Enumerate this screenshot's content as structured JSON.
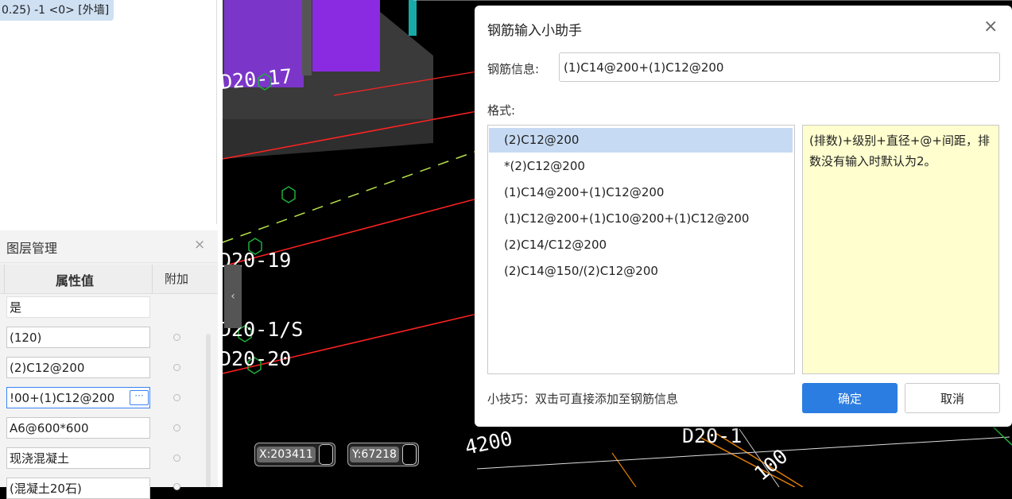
{
  "left_panel": {
    "selected_item": "0.25) -1 <0> [外墙]",
    "layer_panel": {
      "title": "图层管理",
      "close": "×",
      "column_value": "属性值",
      "column_extra": "附加",
      "rows": [
        "是",
        "(120)",
        "(2)C12@200",
        "!00+(1)C12@200",
        "A6@600*600",
        "现浇混凝土",
        "(混凝土20石)"
      ],
      "ellipsis": "···"
    },
    "collapse_arrow": "‹"
  },
  "cad": {
    "labels": [
      "D20-17",
      "D20-19",
      "D20-1/S",
      "D20-20",
      "D20-1",
      "4200",
      "100"
    ],
    "coord_x": "X:203411",
    "coord_y": "Y:67218"
  },
  "dialog": {
    "title": "钢筋输入小助手",
    "close": "×",
    "info_label": "钢筋信息:",
    "info_value": "(1)C14@200+(1)C12@200",
    "format_label": "格式:",
    "formats": [
      "(2)C12@200",
      "*(2)C12@200",
      "(1)C14@200+(1)C12@200",
      "(1)C12@200+(1)C10@200+(1)C12@200",
      "(2)C14/C12@200",
      "(2)C14@150/(2)C12@200"
    ],
    "selected_format_index": 0,
    "description": "(排数)+级别+直径+@+间距，排数没有输入时默认为2。",
    "tip": "小技巧：双击可直接添加至钢筋信息",
    "ok": "确定",
    "cancel": "取消"
  },
  "colors": {
    "accent": "#2b7de1",
    "selection": "#c6dbf3",
    "description_bg": "#fefece",
    "cad_background": "#000000",
    "wall_purple": "#7b36c9"
  }
}
